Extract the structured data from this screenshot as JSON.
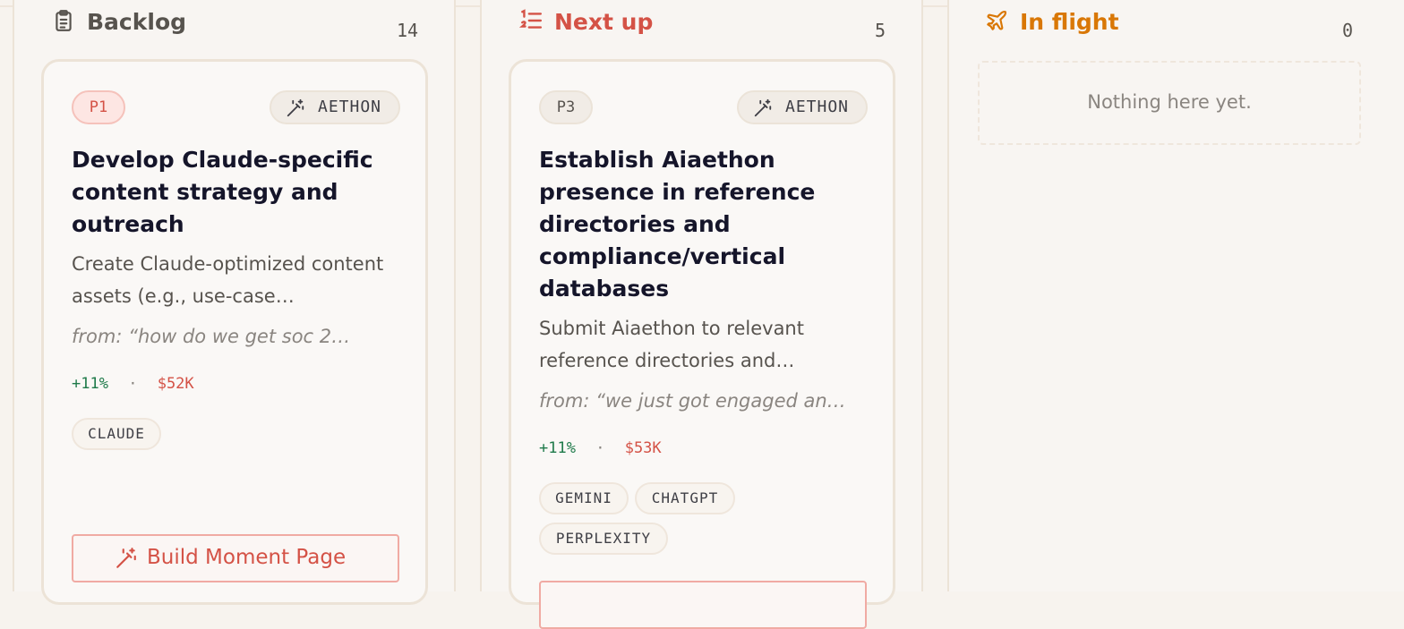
{
  "columns": [
    {
      "title": "Backlog",
      "icon": "clipboard-icon",
      "count": "14",
      "color": "#57534e",
      "cards": [
        {
          "priority": "P1",
          "brand": "AETHON",
          "title": "Develop Claude-specific content strategy and outreach",
          "description": "Create Claude-optimized content assets (e.g., use-case…",
          "source": "from: “how do we get soc 2…",
          "lift": "+11%",
          "separator": "·",
          "value": "$52K",
          "tags": [
            "CLAUDE"
          ],
          "action": "Build Moment Page"
        }
      ]
    },
    {
      "title": "Next up",
      "icon": "list-ordered-icon",
      "count": "5",
      "color": "#d45246",
      "cards": [
        {
          "priority": "P3",
          "brand": "AETHON",
          "title": "Establish Aiaethon presence in reference directories and compliance/vertical databases",
          "description": "Submit Aiaethon to relevant reference directories and…",
          "source": "from: “we just got engaged an…",
          "lift": "+11%",
          "separator": "·",
          "value": "$53K",
          "tags": [
            "GEMINI",
            "CHATGPT",
            "PERPLEXITY"
          ]
        }
      ]
    },
    {
      "title": "In flight",
      "icon": "plane-icon",
      "count": "0",
      "color": "#d97706",
      "empty_text": "Nothing here yet."
    }
  ],
  "colors": {
    "background": "#f7f3ee",
    "card_border": "#ece3d7",
    "accent_red": "#d45246",
    "accent_amber": "#d97706",
    "positive_green": "#1f7a4a"
  }
}
